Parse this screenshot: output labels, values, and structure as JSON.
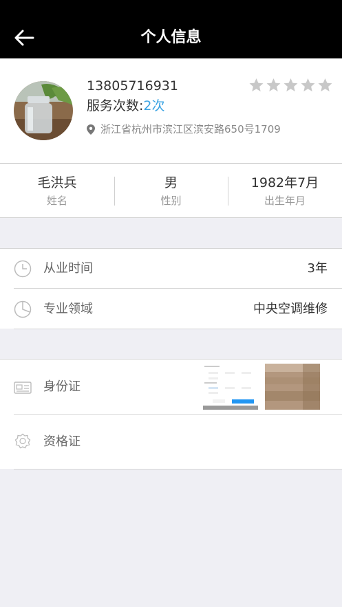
{
  "nav": {
    "title": "个人信息",
    "back_icon": "arrow-left-icon"
  },
  "profile": {
    "phone": "13805716931",
    "rating": 0,
    "rating_max": 5,
    "service_label": "服务次数:",
    "service_count": "2次",
    "address": "浙江省杭州市滨江区滨安路650号1709",
    "colors": {
      "accent": "#3aa3e3",
      "star": "#c8c8c8"
    }
  },
  "basic_info": [
    {
      "value": "毛洪兵",
      "label": "姓名"
    },
    {
      "value": "男",
      "label": "性别"
    },
    {
      "value": "1982年7月",
      "label": "出生年月"
    }
  ],
  "work": {
    "experience": {
      "icon": "clock-icon",
      "label": "从业时间",
      "value": "3年"
    },
    "field": {
      "icon": "pie-chart-icon",
      "label": "专业领域",
      "value": "中央空调维修"
    }
  },
  "documents": {
    "id_card": {
      "icon": "id-card-icon",
      "label": "身份证"
    },
    "certificate": {
      "icon": "certificate-icon",
      "label": "资格证"
    }
  }
}
